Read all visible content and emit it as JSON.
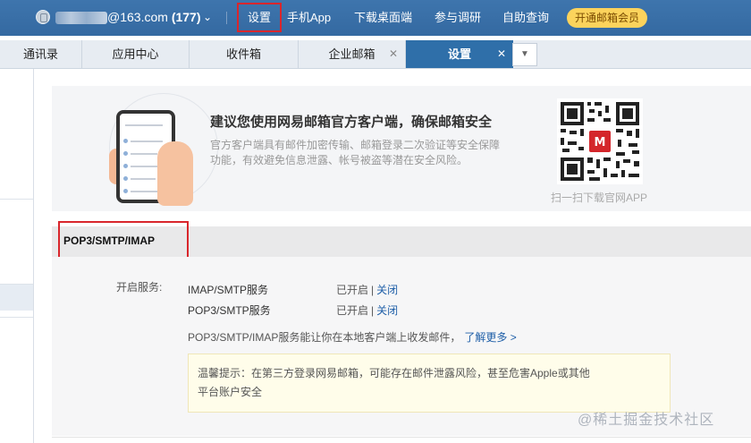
{
  "topbar": {
    "account_suffix": "@163.com",
    "unread_count": "(177)",
    "nav": [
      {
        "label": "设置"
      },
      {
        "label": "手机App"
      },
      {
        "label": "下载桌面端"
      },
      {
        "label": "参与调研"
      },
      {
        "label": "自助查询"
      }
    ],
    "vip_label": "开通邮箱会员"
  },
  "tabs": [
    {
      "label": "通讯录"
    },
    {
      "label": "应用中心"
    },
    {
      "label": "收件箱"
    },
    {
      "label": "企业邮箱"
    },
    {
      "label": "设置"
    }
  ],
  "promo": {
    "title": "建议您使用网易邮箱官方客户端，确保邮箱安全",
    "desc": "官方客户端具有邮件加密传输、邮箱登录二次验证等安全保障功能，有效避免信息泄露、帐号被盗等潜在安全风险。",
    "qr_caption": "扫一扫下载官网APP"
  },
  "section": {
    "title": "POP3/SMTP/IMAP",
    "service_label": "开启服务:",
    "services": [
      {
        "name": "IMAP/SMTP服务",
        "status": "已开启",
        "action": "关闭"
      },
      {
        "name": "POP3/SMTP服务",
        "status": "已开启",
        "action": "关闭"
      }
    ],
    "note": "POP3/SMTP/IMAP服务能让你在本地客户端上收发邮件，",
    "learn_more": "了解更多 >",
    "tip_line1": "温馨提示：在第三方登录网易邮箱，可能存在邮件泄露风险，甚至危害Apple或其他",
    "tip_line2": "平台账户安全"
  },
  "watermark": "@稀土掘金技术社区",
  "colors": {
    "topbar": "#3469a1",
    "active_tab": "#2f6fa9",
    "highlight_border": "#d9262c",
    "vip": "#fcd35c",
    "link": "#1f5fa8"
  }
}
